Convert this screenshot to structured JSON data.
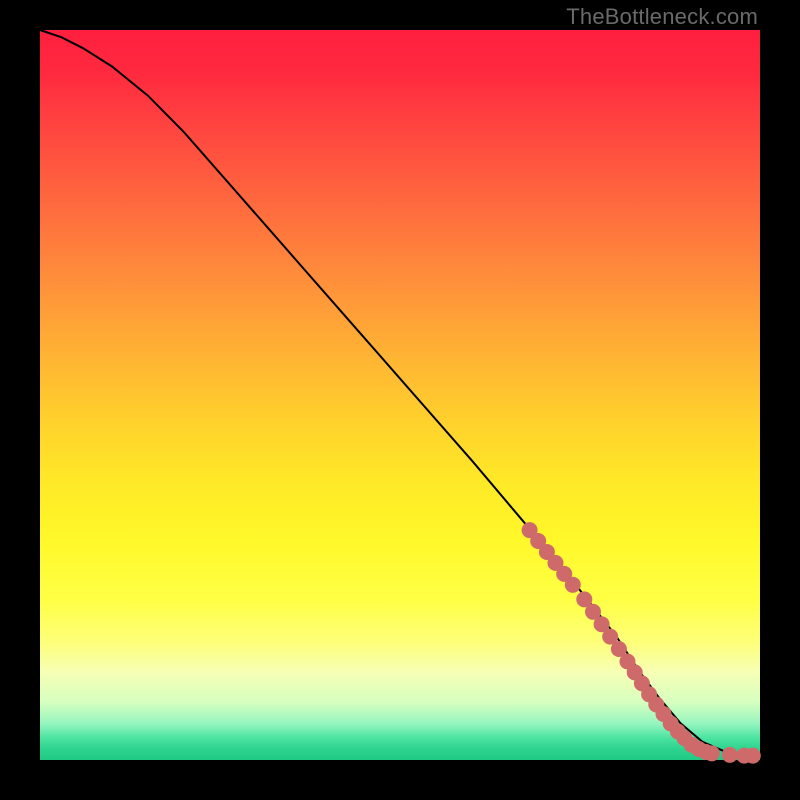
{
  "watermark": "TheBottleneck.com",
  "colors": {
    "frame": "#000000",
    "curve": "#000000",
    "markers": "#cf6a6a",
    "gradient_top": "#ff1f3f",
    "gradient_bottom": "#1fc984"
  },
  "chart_data": {
    "type": "line",
    "title": "",
    "xlabel": "",
    "ylabel": "",
    "xlim": [
      0,
      100
    ],
    "ylim": [
      0,
      100
    ],
    "grid": false,
    "legend": false,
    "series": [
      {
        "name": "bottleneck-curve",
        "x": [
          0,
          3,
          6,
          10,
          15,
          20,
          28,
          36,
          44,
          52,
          60,
          66,
          72,
          76,
          80,
          83,
          86,
          89,
          92,
          95,
          98,
          100
        ],
        "y": [
          100,
          99,
          97.5,
          95,
          91,
          86,
          77,
          68,
          59,
          50,
          41,
          34,
          27,
          22,
          17,
          12.5,
          8.5,
          5,
          2.5,
          1.2,
          0.6,
          0.5
        ]
      }
    ],
    "markers": [
      {
        "x": 68.0,
        "y": 31.5
      },
      {
        "x": 69.2,
        "y": 30.0
      },
      {
        "x": 70.4,
        "y": 28.5
      },
      {
        "x": 71.6,
        "y": 27.0
      },
      {
        "x": 72.8,
        "y": 25.5
      },
      {
        "x": 74.0,
        "y": 24.0
      },
      {
        "x": 75.6,
        "y": 22.0
      },
      {
        "x": 76.8,
        "y": 20.3
      },
      {
        "x": 78.0,
        "y": 18.6
      },
      {
        "x": 79.2,
        "y": 16.9
      },
      {
        "x": 80.4,
        "y": 15.2
      },
      {
        "x": 81.6,
        "y": 13.5
      },
      {
        "x": 82.6,
        "y": 12.0
      },
      {
        "x": 83.6,
        "y": 10.5
      },
      {
        "x": 84.6,
        "y": 9.0
      },
      {
        "x": 85.6,
        "y": 7.6
      },
      {
        "x": 86.6,
        "y": 6.3
      },
      {
        "x": 87.6,
        "y": 5.0
      },
      {
        "x": 88.6,
        "y": 3.9
      },
      {
        "x": 89.5,
        "y": 3.0
      },
      {
        "x": 90.5,
        "y": 2.1
      },
      {
        "x": 91.5,
        "y": 1.5
      },
      {
        "x": 92.5,
        "y": 1.1
      },
      {
        "x": 93.3,
        "y": 0.9
      },
      {
        "x": 95.8,
        "y": 0.7
      },
      {
        "x": 97.8,
        "y": 0.6
      },
      {
        "x": 99.0,
        "y": 0.6
      }
    ],
    "marker_radius_px": 8
  }
}
